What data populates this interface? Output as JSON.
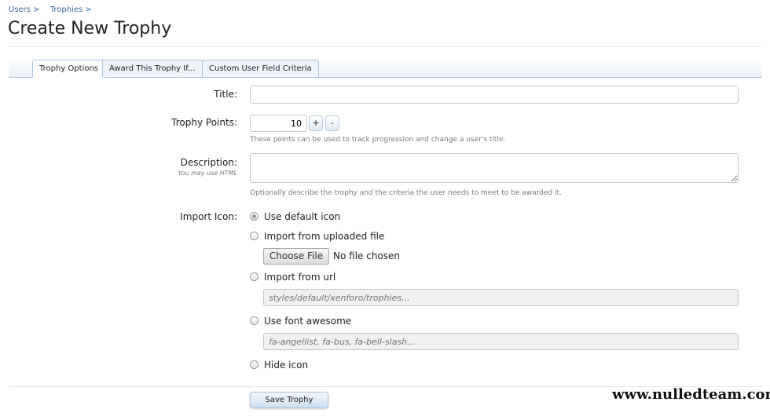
{
  "breadcrumb": [
    "Users >",
    "Trophies >"
  ],
  "page_title": "Create New Trophy",
  "tabs": [
    {
      "label": "Trophy Options",
      "active": true
    },
    {
      "label": "Award This Trophy If...",
      "active": false
    },
    {
      "label": "Custom User Field Criteria",
      "active": false
    }
  ],
  "form": {
    "title_label": "Title:",
    "title_value": "",
    "points_label": "Trophy Points:",
    "points_value": "10",
    "points_plus": "+",
    "points_minus": "-",
    "points_hint": "These points can be used to track progression and change a user's title.",
    "description_label": "Description:",
    "description_sublabel": "You may use HTML",
    "description_value": "",
    "description_hint": "Optionally describe the trophy and the criteria the user needs to meet to be awarded it.",
    "icon_label": "Import Icon:",
    "icon_options": [
      {
        "label": "Use default icon",
        "checked": true
      },
      {
        "label": "Import from uploaded file",
        "checked": false
      },
      {
        "label": "Import from url",
        "checked": false
      },
      {
        "label": "Use font awesome",
        "checked": false
      },
      {
        "label": "Hide icon",
        "checked": false
      }
    ],
    "file_button": "Choose File",
    "file_status": "No file chosen",
    "url_placeholder": "styles/default/xenforo/trophies...",
    "fa_placeholder": "fa-angellist, fa-bus, fa-bell-slash..."
  },
  "save_button": "Save Trophy",
  "watermark": "www.nulledteam.com"
}
